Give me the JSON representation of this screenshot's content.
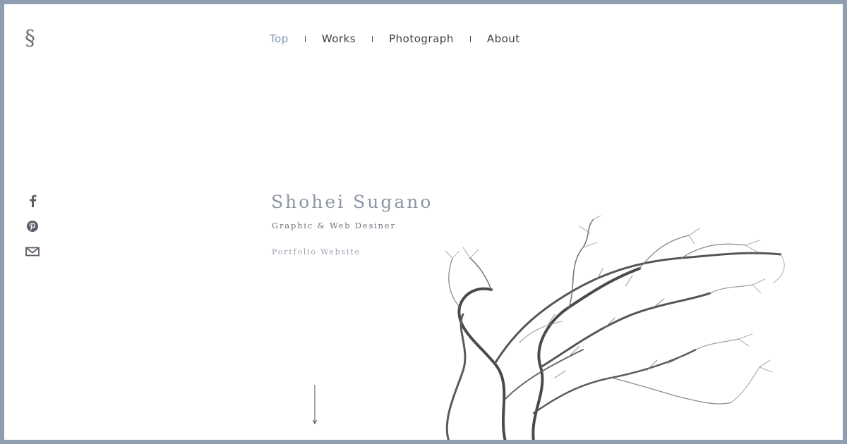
{
  "logo": {
    "glyph": "§"
  },
  "nav": {
    "items": [
      {
        "label": "Top",
        "active": true
      },
      {
        "label": "Works",
        "active": false
      },
      {
        "label": "Photograph",
        "active": false
      },
      {
        "label": "About",
        "active": false
      }
    ]
  },
  "social": {
    "icons": [
      "facebook-icon",
      "pinterest-icon",
      "mail-icon"
    ]
  },
  "hero": {
    "name": "Shohei Sugano",
    "role": "Graphic & Web Desiner",
    "subtitle": "Portfolio Website"
  },
  "colors": {
    "frame": "#8f9db0",
    "background": "#ffffff",
    "accent": "#7d97bb",
    "text": "#3e4148",
    "name": "#8d95a6"
  }
}
